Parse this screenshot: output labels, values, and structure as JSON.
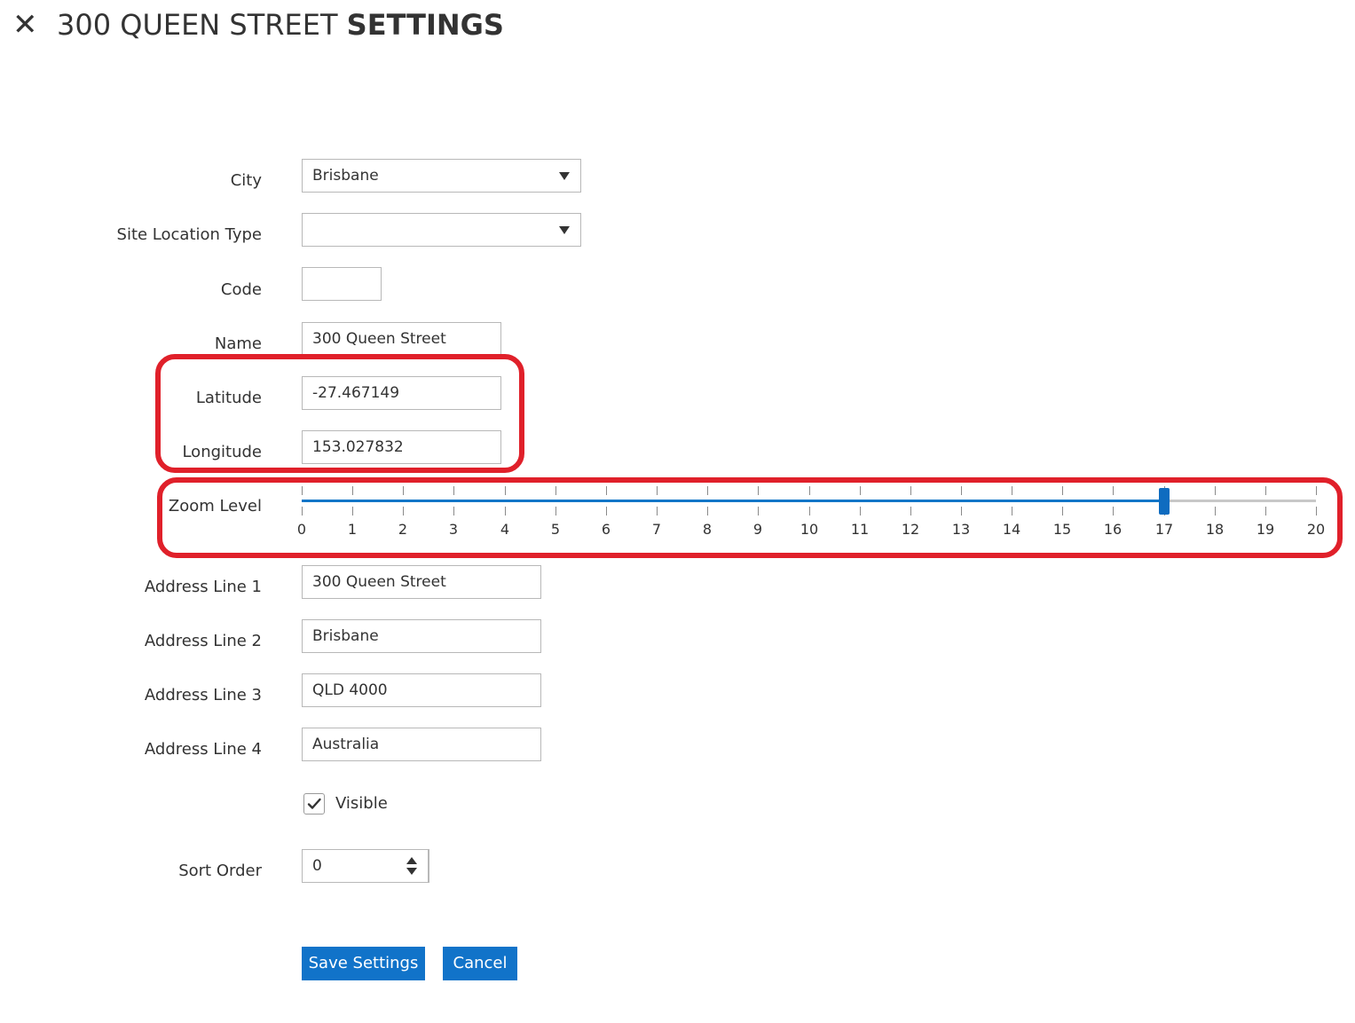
{
  "header": {
    "close_icon": "close-icon",
    "title_regular": "300 QUEEN STREET ",
    "title_bold": "SETTINGS"
  },
  "form": {
    "city": {
      "label": "City",
      "value": "Brisbane"
    },
    "site_location_type": {
      "label": "Site Location Type",
      "value": ""
    },
    "code": {
      "label": "Code",
      "value": ""
    },
    "name": {
      "label": "Name",
      "value": "300 Queen Street"
    },
    "latitude": {
      "label": "Latitude",
      "value": "-27.467149"
    },
    "longitude": {
      "label": "Longitude",
      "value": "153.027832"
    },
    "zoom": {
      "label": "Zoom Level",
      "value": 17,
      "min": 0,
      "max": 20,
      "ticks": [
        "0",
        "1",
        "2",
        "3",
        "4",
        "5",
        "6",
        "7",
        "8",
        "9",
        "10",
        "11",
        "12",
        "13",
        "14",
        "15",
        "16",
        "17",
        "18",
        "19",
        "20"
      ]
    },
    "address1": {
      "label": "Address Line 1",
      "value": "300 Queen Street"
    },
    "address2": {
      "label": "Address Line 2",
      "value": "Brisbane"
    },
    "address3": {
      "label": "Address Line 3",
      "value": "QLD 4000"
    },
    "address4": {
      "label": "Address Line 4",
      "value": "Australia"
    },
    "visible": {
      "label": "Visible",
      "checked": true
    },
    "sort_order": {
      "label": "Sort Order",
      "value": "0"
    }
  },
  "actions": {
    "save_label": "Save Settings",
    "cancel_label": "Cancel"
  },
  "colors": {
    "accent": "#1173c9",
    "highlight": "#e0202a"
  }
}
